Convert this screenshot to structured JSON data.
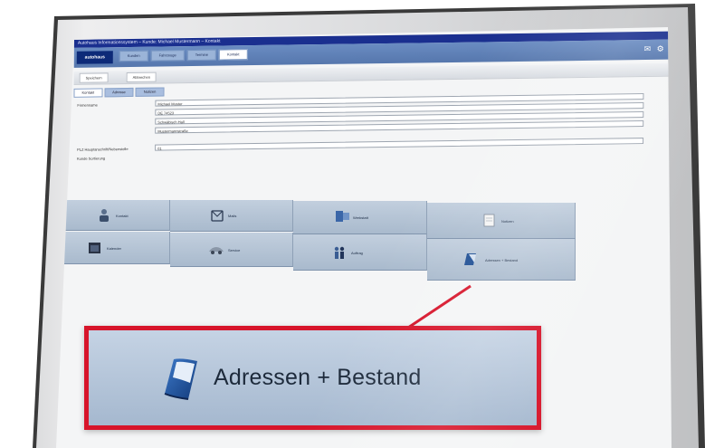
{
  "window": {
    "title": "Autohaus Informationssystem – Kunde: Michael Mustermann – Kontakt",
    "logo": "autohaus"
  },
  "menu": {
    "tabs": [
      "Kunden",
      "Fahrzeuge",
      "Termine",
      "Kontakt"
    ],
    "right_icons": "✉ ⚙"
  },
  "toolbar": {
    "buttons": [
      "Speichern",
      "Abbrechen"
    ]
  },
  "subtabs": [
    "Kontakt",
    "Adresse",
    "Notizen"
  ],
  "form": {
    "label_name": "Firmenname",
    "label_cat": "PLZ Hauptanschrift/Nebenstelle",
    "label_sort": "Kunde Sortierung",
    "fields": [
      "Michael Muster",
      "DE 74523",
      "Schwäbisch Hall",
      "Mustermannstraße",
      "01"
    ]
  },
  "tiles": [
    {
      "label": "Kontakt",
      "icon": "person-icon"
    },
    {
      "label": "Mails",
      "icon": "mail-icon"
    },
    {
      "label": "Werkstatt",
      "icon": "workshop-icon"
    },
    {
      "label": "Notizen",
      "icon": "notes-icon"
    },
    {
      "label": "Kalender",
      "icon": "calendar-icon"
    },
    {
      "label": "Service",
      "icon": "car-icon"
    },
    {
      "label": "Auftrag",
      "icon": "people-icon"
    },
    {
      "label": "Adressen + Bestand",
      "icon": "address-book-icon"
    }
  ],
  "callout": {
    "label": "Adressen + Bestand",
    "icon": "address-book-icon",
    "border_color": "#d7142a"
  },
  "colors": {
    "title_bar": "#1a2f8f",
    "menu_bar": "#5677ad",
    "tile": "#b5c5d8"
  }
}
